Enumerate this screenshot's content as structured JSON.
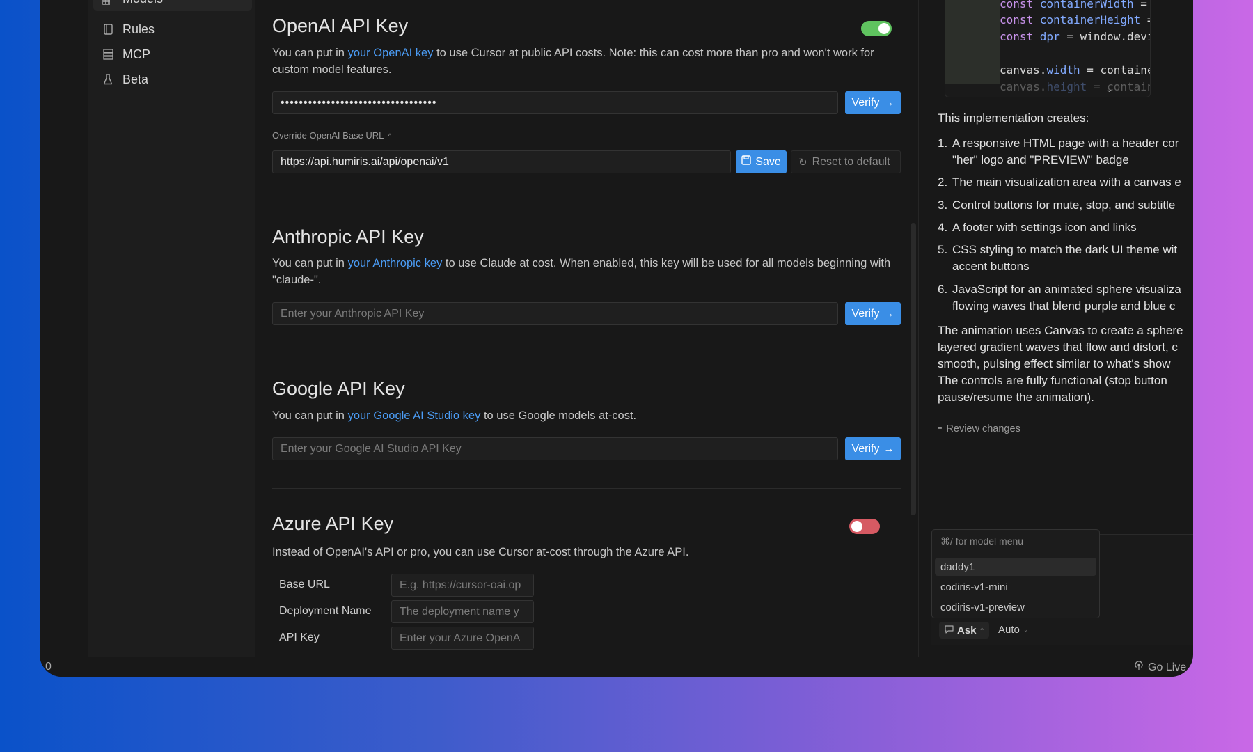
{
  "sidebar": {
    "items": [
      {
        "label": "Models",
        "icon": "chart-icon"
      },
      {
        "label": "Rules",
        "icon": "document-icon"
      },
      {
        "label": "MCP",
        "icon": "server-icon"
      },
      {
        "label": "Beta",
        "icon": "flask-icon"
      }
    ]
  },
  "openai": {
    "title": "OpenAI API Key",
    "desc_pre": "You can put in ",
    "desc_link": "your OpenAI key",
    "desc_post": " to use Cursor at public API costs. Note: this can cost more than pro and won't work for custom model features.",
    "key_value": "••••••••••••••••••••••••••••••••••",
    "verify": "Verify",
    "override_label": "Override OpenAI Base URL",
    "base_url": "https://api.humiris.ai/api/openai/v1",
    "save": "Save",
    "reset": "Reset to default",
    "enabled": true
  },
  "anthropic": {
    "title": "Anthropic API Key",
    "desc_pre": "You can put in ",
    "desc_link": "your Anthropic key",
    "desc_post": " to use Claude at cost. When enabled, this key will be used for all models beginning with \"claude-\".",
    "placeholder": "Enter your Anthropic API Key",
    "verify": "Verify"
  },
  "google": {
    "title": "Google API Key",
    "desc_pre": "You can put in ",
    "desc_link": "your Google AI Studio key",
    "desc_post": " to use Google models at-cost.",
    "placeholder": "Enter your Google AI Studio API Key",
    "verify": "Verify"
  },
  "azure": {
    "title": "Azure API Key",
    "desc": "Instead of OpenAI's API or pro, you can use Cursor at-cost through the Azure API.",
    "enabled": false,
    "fields": [
      {
        "label": "Base URL",
        "placeholder": "E.g. https://cursor-oai.op"
      },
      {
        "label": "Deployment Name",
        "placeholder": "The deployment name y"
      },
      {
        "label": "API Key",
        "placeholder": "Enter your Azure OpenA"
      }
    ]
  },
  "chat": {
    "code_lines": [
      [
        "const ",
        "containerWidth",
        " = canvas"
      ],
      [
        "const ",
        "containerHeight",
        " = canva"
      ],
      [
        "const ",
        "dpr",
        " = window.devicePix"
      ],
      [
        "",
        "",
        ""
      ],
      [
        "canvas.",
        "width",
        " = containerWidt"
      ],
      [
        "canvas.",
        "height",
        " = containerHei"
      ]
    ],
    "intro": "This implementation creates:",
    "list": [
      [
        "1.",
        "A responsive HTML page with a header cor",
        "\"her\" logo and \"PREVIEW\" badge"
      ],
      [
        "2.",
        "The main visualization area with a canvas e",
        ""
      ],
      [
        "3.",
        "Control buttons for mute, stop, and subtitle",
        ""
      ],
      [
        "4.",
        "A footer with settings icon and links",
        ""
      ],
      [
        "5.",
        "CSS styling to match the dark UI theme wit",
        "accent buttons"
      ],
      [
        "6.",
        "JavaScript for an animated sphere visualiza",
        "flowing waves that blend purple and blue c"
      ]
    ],
    "para": [
      "The animation uses Canvas to create a sphere",
      "layered gradient waves that flow and distort, c",
      "smooth, pulsing effect similar to what's show",
      "The controls are fully functional (stop button",
      "pause/resume the animation)."
    ],
    "review": "Review changes",
    "model_hint": "⌘/ for model menu",
    "models": [
      "daddy1",
      "codiris-v1-mini",
      "codiris-v1-preview"
    ],
    "mode": "Ask",
    "auto": "Auto"
  },
  "status": {
    "left": "0",
    "right": "Go Live"
  },
  "colors": {
    "accent": "#3a8ee6",
    "link": "#4b9cf5",
    "toggle_on": "#5fc35f",
    "toggle_off": "#d65a63"
  }
}
